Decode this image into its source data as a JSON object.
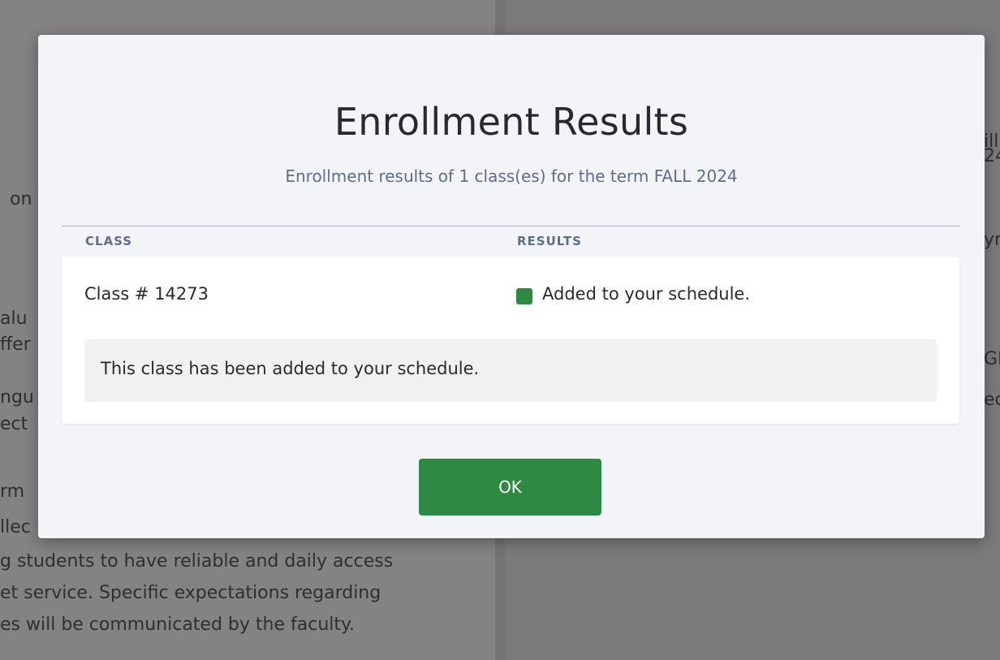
{
  "background": {
    "right_fragments": [
      "ill",
      "24",
      "yr",
      "GE",
      "ec"
    ],
    "left_fragments": [
      "on",
      "alu",
      "ffer",
      "ngu",
      "ect",
      "rm",
      "llec"
    ],
    "bottom_lines": [
      "g students to have reliable and daily access",
      "et service. Specific expectations regarding",
      "es will be communicated by the faculty."
    ]
  },
  "modal": {
    "title": "Enrollment Results",
    "subtitle": "Enrollment results of 1 class(es) for the term FALL 2024",
    "table": {
      "headers": [
        "CLASS",
        "RESULTS"
      ],
      "rows": [
        {
          "class": "Class # 14273",
          "result": "Added to your schedule.",
          "status_color": "#2e8a43",
          "message": "This class has been added to your schedule."
        }
      ]
    },
    "ok_label": "OK"
  },
  "colors": {
    "accent_green": "#2e8a43",
    "header_text": "#5f6d85",
    "overlay": "#7b7b7b"
  }
}
